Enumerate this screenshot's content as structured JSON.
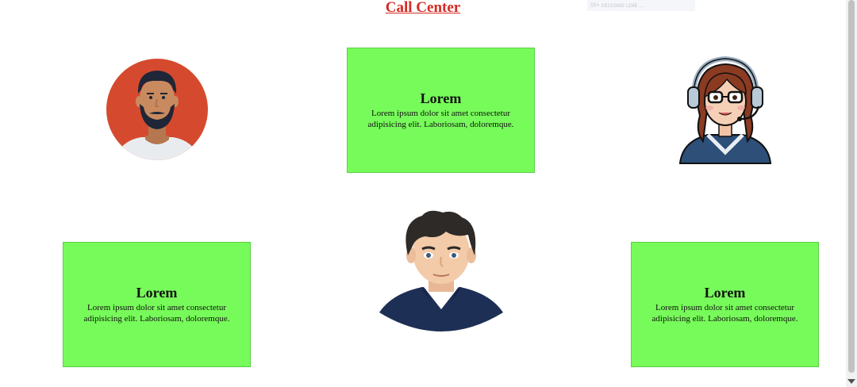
{
  "page": {
    "title": "Call Center",
    "ghost_text": "//ꜰ• ꜱᴇᴄᴄᴏɴᴅ ʟɪɴᴇ ..."
  },
  "cards": [
    {
      "heading": "Lorem",
      "body": "Lorem ipsum dolor sit amet consectetur adipisicing elit. Laboriosam, doloremque."
    },
    {
      "heading": "Lorem",
      "body": "Lorem ipsum dolor sit amet consectetur adipisicing elit. Laboriosam, doloremque."
    },
    {
      "heading": "Lorem",
      "body": "Lorem ipsum dolor sit amet consectetur adipisicing elit. Laboriosam, doloremque."
    }
  ],
  "colors": {
    "title": "#d42a25",
    "card_bg": "#77fb5a",
    "card_border": "#5ad043",
    "avatar_circle": "#d54a2e"
  },
  "icons": [
    "bearded-man-avatar",
    "headset-agent-avatar",
    "young-man-avatar"
  ]
}
